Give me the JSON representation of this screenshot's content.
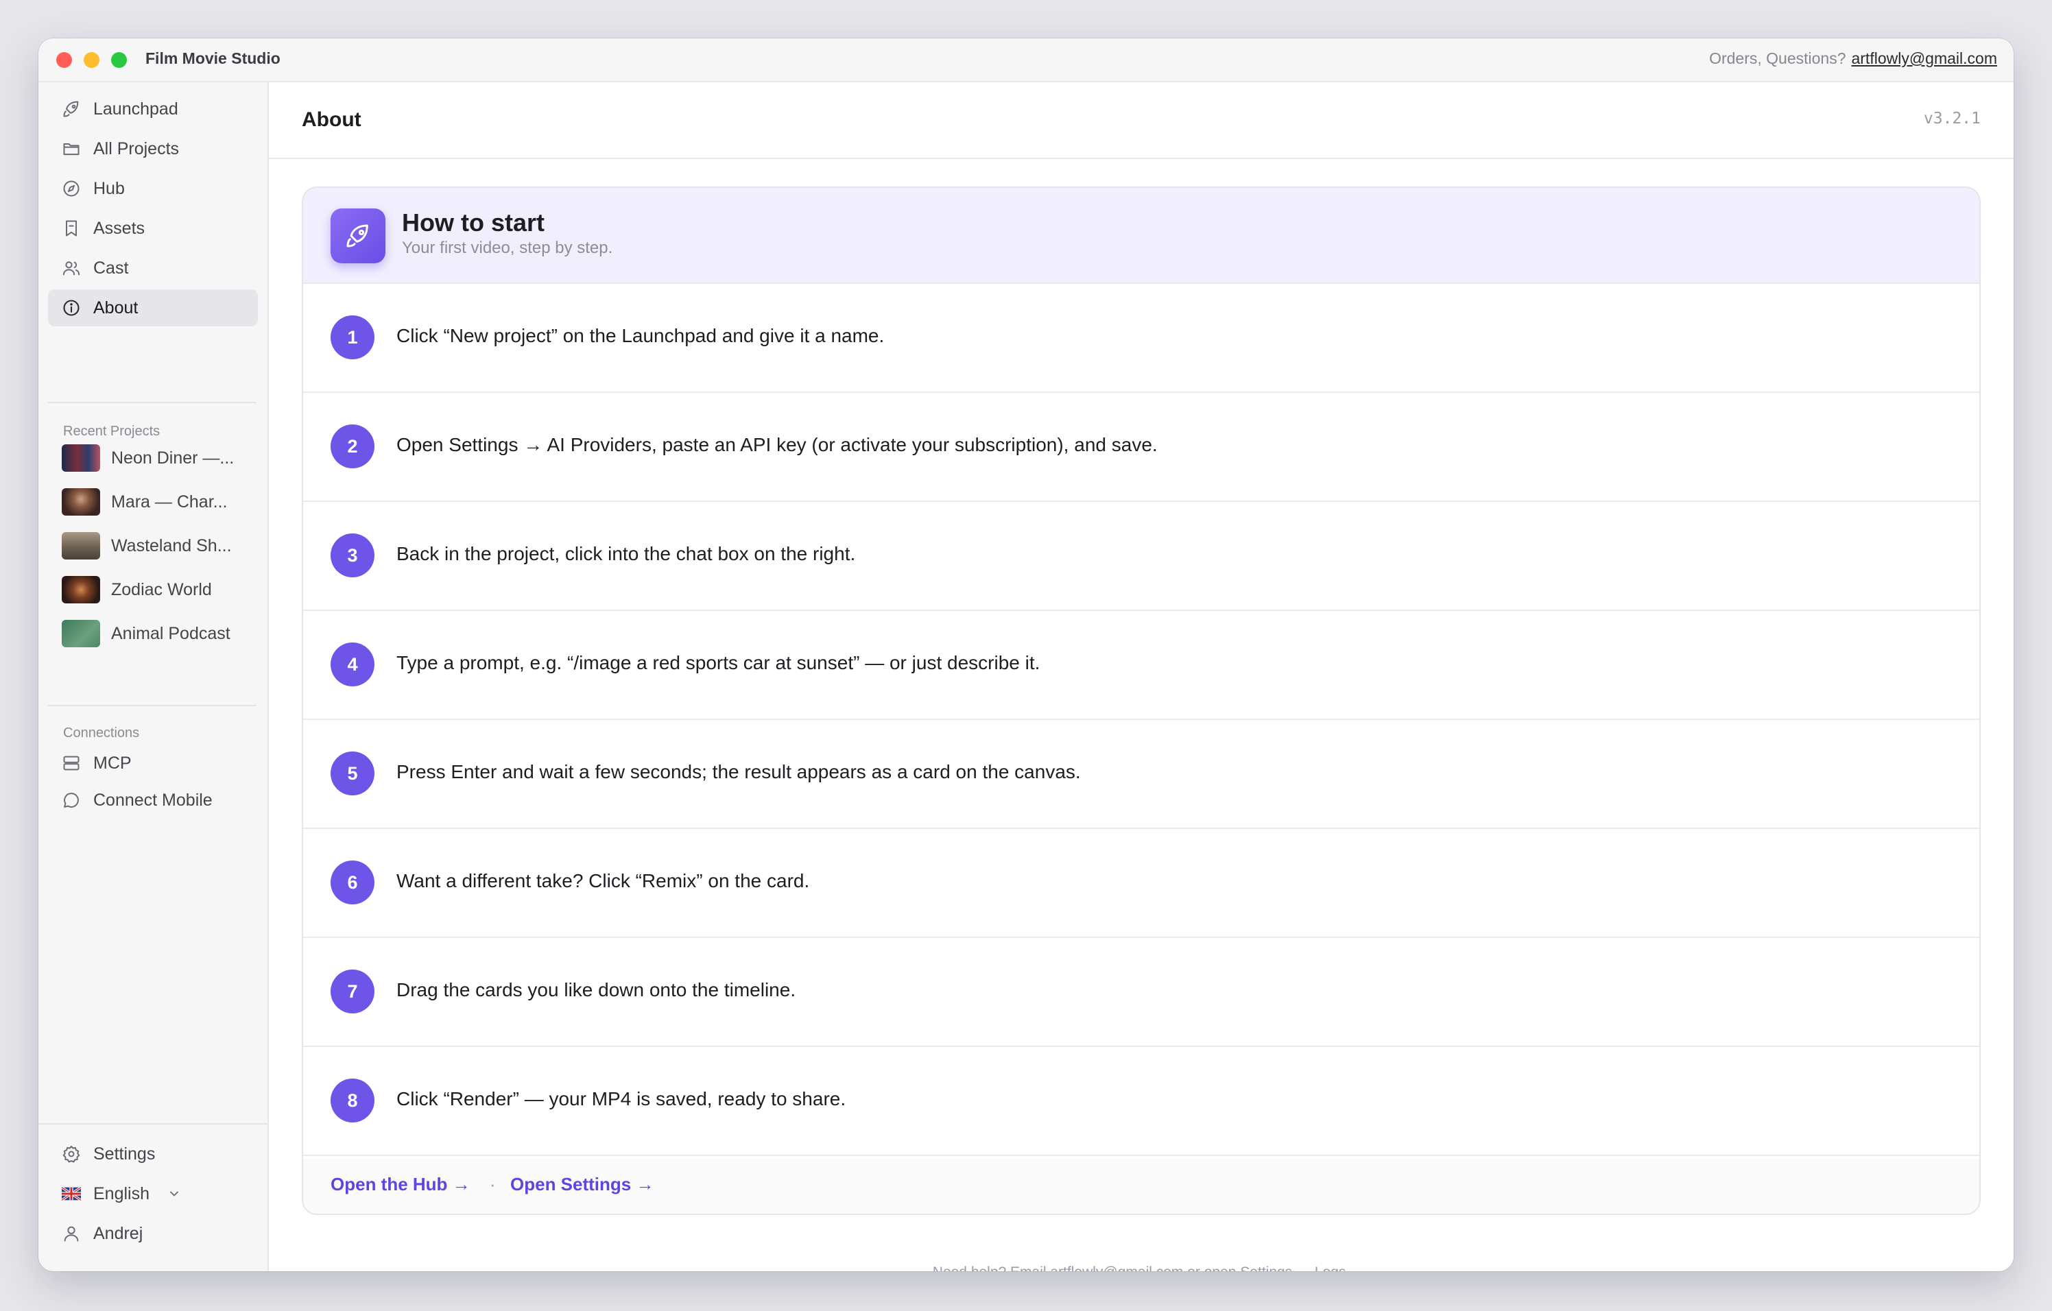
{
  "app": {
    "name": "Film Movie Studio",
    "contact_label": "Orders, Questions?",
    "contact_email": "artflowly@gmail.com"
  },
  "sidebar": {
    "nav": [
      {
        "label": "Launchpad",
        "icon": "rocket-icon"
      },
      {
        "label": "All Projects",
        "icon": "folder-icon"
      },
      {
        "label": "Hub",
        "icon": "compass-icon"
      },
      {
        "label": "Assets",
        "icon": "bookmark-icon"
      },
      {
        "label": "Cast",
        "icon": "users-icon"
      },
      {
        "label": "About",
        "icon": "info-icon",
        "active": true
      }
    ],
    "recent_title": "Recent Projects",
    "recent": [
      {
        "label": "Neon Diner —..."
      },
      {
        "label": "Mara — Char..."
      },
      {
        "label": "Wasteland Sh..."
      },
      {
        "label": "Zodiac World"
      },
      {
        "label": "Animal Podcast"
      }
    ],
    "connections_title": "Connections",
    "connections": [
      {
        "label": "MCP",
        "icon": "server-icon"
      },
      {
        "label": "Connect Mobile",
        "icon": "chat-bubble-icon"
      }
    ],
    "bottom": {
      "settings": "Settings",
      "language": "English",
      "user": "Andrej"
    }
  },
  "main": {
    "title": "About",
    "version": "v3.2.1",
    "card": {
      "title": "How to start",
      "subtitle": "Your first video, step by step.",
      "steps": [
        {
          "n": "1",
          "text": "Click “New project” on the Launchpad and give it a name."
        },
        {
          "n": "2",
          "text": "Open Settings → AI Providers, paste an API key (or activate your subscription), and save."
        },
        {
          "n": "3",
          "text": "Back in the project, click into the chat box on the right."
        },
        {
          "n": "4",
          "text": "Type a prompt, e.g. “/image a red sports car at sunset” — or just describe it."
        },
        {
          "n": "5",
          "text": "Press Enter and wait a few seconds; the result appears as a card on the canvas."
        },
        {
          "n": "6",
          "text": "Want a different take? Click “Remix” on the card."
        },
        {
          "n": "7",
          "text": "Drag the cards you like down onto the timeline."
        },
        {
          "n": "8",
          "text": "Click “Render” — your MP4 is saved, ready to share."
        }
      ],
      "footer_links": [
        "Open the Hub →",
        "Open Settings →"
      ],
      "footer_separator": "·"
    },
    "help_text": "Need help? Email artflowly@gmail.com or open Settings → Logs."
  },
  "colors": {
    "accent": "#6e55e8",
    "link": "#5b47e0",
    "header_tint": "#f1effd"
  }
}
